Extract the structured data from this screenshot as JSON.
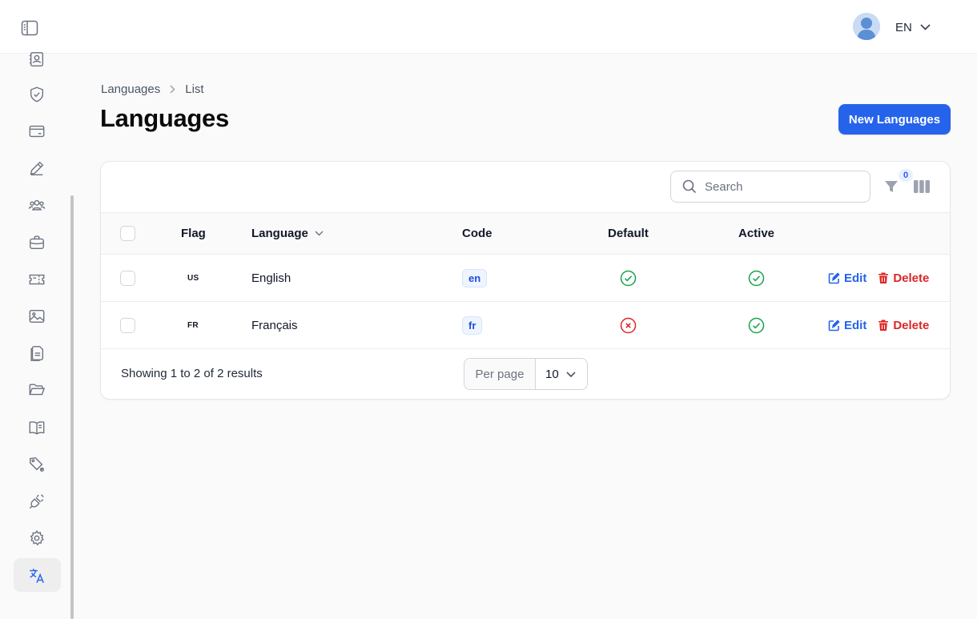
{
  "topbar": {
    "locale": "EN"
  },
  "breadcrumb": {
    "items": [
      "Languages",
      "List"
    ]
  },
  "page": {
    "title": "Languages",
    "new_button": "New Languages"
  },
  "toolbar": {
    "search_placeholder": "Search",
    "filter_count": "0"
  },
  "table": {
    "columns": {
      "flag": "Flag",
      "language": "Language",
      "code": "Code",
      "default": "Default",
      "active": "Active"
    },
    "rows": [
      {
        "flag": "US",
        "language": "English",
        "code": "en",
        "default": true,
        "active": true,
        "edit": "Edit",
        "delete": "Delete"
      },
      {
        "flag": "FR",
        "language": "Français",
        "code": "fr",
        "default": false,
        "active": true,
        "edit": "Edit",
        "delete": "Delete"
      }
    ]
  },
  "footer": {
    "showing": "Showing 1 to 2 of 2 results",
    "per_page_label": "Per page",
    "per_page_value": "10"
  },
  "colors": {
    "primary": "#2563eb",
    "success": "#16a34a",
    "danger": "#dc2626"
  },
  "sidebar": {
    "icons": [
      "contacts-icon",
      "shield-icon",
      "credit-card-icon",
      "pencil-icon",
      "users-icon",
      "briefcase-icon",
      "ticket-icon",
      "image-icon",
      "documents-icon",
      "folder-open-icon",
      "book-icon",
      "tags-icon",
      "plug-icon",
      "settings-icon",
      "translate-icon"
    ],
    "active": "translate-icon"
  }
}
